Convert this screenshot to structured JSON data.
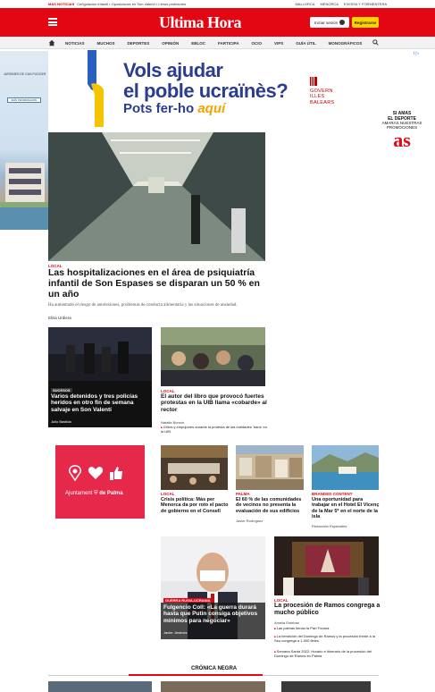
{
  "ticker": {
    "hot_label": "MÁS NOTICIAS",
    "hot_text": "Ceñgulación infantil • Oposiciones en Son Valentí • Libros profesores",
    "right_links": [
      "MALLORCA",
      "MENORCA",
      "EIVISSA Y FORMENTERA"
    ]
  },
  "header": {
    "logo": "Ultima Hora",
    "login": "Iniciar sesión",
    "register": "Registrarse"
  },
  "nav": {
    "items": [
      "NOTICIAS",
      "MUCHOS",
      "DEPORTES",
      "OPINIÓN",
      "EBLOC",
      "FARTICIPA",
      "OCIO",
      "VIPS",
      "GUÍA ÚTIL",
      "MONOGRÁFICOS"
    ]
  },
  "ad_top": {
    "line1": "Vols ajudar",
    "line2": "el poble ucraïnès?",
    "line3_a": "Pots fer-ho",
    "line3_b": "aquí",
    "govern": [
      "GOVERN",
      "ILLES",
      "BALEARS"
    ],
    "corner": "i ▷"
  },
  "ad_right": {
    "line1": "SI AMAS",
    "line2": "EL DEPORTE",
    "line3": "AMARÁS NUESTRAS",
    "line4": "PROMOCIONES",
    "brand": "as"
  },
  "ad_left": {
    "caption": "JARDINES DE CAN FUGGER",
    "button": "MÁS INFORMACIÓN"
  },
  "hero": {
    "tag": "LOCAL",
    "title": "Las hospitalizaciones en el área de psiquiatría infantil de Son Espases se disparan un 50 % en un año",
    "subtitle": "Ha aumentado el riesgo de autolesiones, problemas de conducta alimentaria y las situaciones de ansiedad.",
    "author": "Elisa Urdiera"
  },
  "card1": {
    "tag": "SUCESOS",
    "title": "Varios detenidos y tres policías heridos en otro fin de semana salvaje en Son Valentí",
    "author": "Julio Bastida"
  },
  "card2": {
    "tag": "LOCAL",
    "title": "El autor del libro que provocó fuertes protestas en la UIB llama «cobarde» al rector",
    "author": "Natalia Bonnín",
    "bullet": "Gritos y empujones durante la protesta de las entidades 'trans' en la UIB"
  },
  "ad_mid": {
    "text_a": "Ajuntament",
    "text_b": "de Palma"
  },
  "card3": {
    "tag": "LOCAL",
    "title": "Crisis política: Más per Menorca da por roto el pacto de gobierno en el Consell",
    "author": ""
  },
  "card4": {
    "tag": "PALMA",
    "title": "El 60 % de las comunidades de vecinos no presenta la evaluación de sus edificios",
    "author": "Javier Rodríguez"
  },
  "card5": {
    "tag": "BRANDED CONTENT",
    "title": "Una oportunidad para trabajar en el Hotel El Vicenç de la Mar 5* en el norte de la isla",
    "author": "Redacción Especiales"
  },
  "card6": {
    "tag": "GUERRA RUSIA-UCRANIA",
    "title": "Fulgencio Coll: «La guerra durará hasta que Putin consiga objetivos mínimos para negociar»",
    "author": "Javier Jiménez"
  },
  "card7": {
    "tag": "LOCAL",
    "title": "La procesión de Ramos congrega a mucho público",
    "author": "Amelia Esteban",
    "bullets": [
      "Las palmas llenan la Part Forana",
      "La bendición del Domingo de Ramos y la procesión frente a la Seu congrega a 1.000 fieles",
      "Semana Santa 2022: Horario e itinerario de la procesión del Domingo de Ramos en Palma"
    ]
  },
  "section": {
    "title": "CRÓNICA NEGRA"
  },
  "colors": {
    "brand_red": "#e30613",
    "register_yellow": "#ffd500",
    "ad_blue": "#2b3d8f",
    "ad_orange": "#f5a300",
    "palma_pink": "#e6294b"
  }
}
